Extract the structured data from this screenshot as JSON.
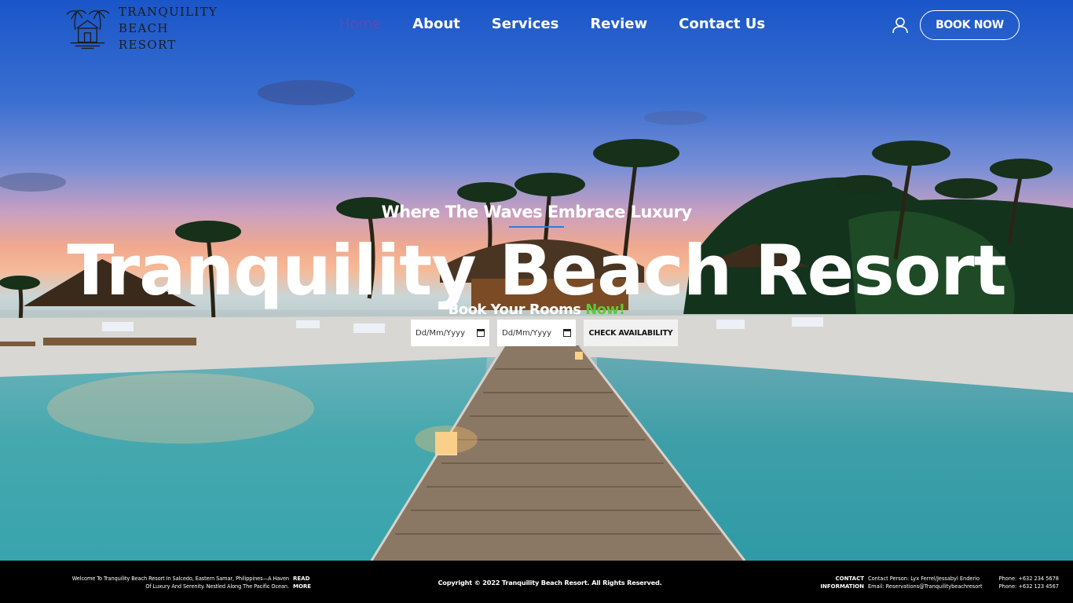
{
  "brand": {
    "line1": "TRANQUILITY",
    "line2": "BEACH RESORT",
    "logo_icon": "palm-hut-logo"
  },
  "nav": {
    "items": [
      {
        "label": "Home",
        "active": true
      },
      {
        "label": "About",
        "active": false
      },
      {
        "label": "Services",
        "active": false
      },
      {
        "label": "Review",
        "active": false
      },
      {
        "label": "Contact Us",
        "active": false
      }
    ],
    "active_color": "#5a4bb8"
  },
  "header": {
    "user_icon": "user-icon",
    "book_now_label": "BOOK NOW"
  },
  "hero": {
    "tagline": "Where The Waves Embrace Luxury",
    "title": "Tranquility Beach Resort",
    "book_prefix": "Book Your Rooms ",
    "book_highlight": "Now!",
    "highlight_color": "#5fc837",
    "checkin_placeholder": "Dd/Mm/Yyyy",
    "checkout_placeholder": "Dd/Mm/Yyyy",
    "calendar_icon": "calendar-icon",
    "check_label": "CHECK AVAILABILITY"
  },
  "footer": {
    "welcome_line1": "Welcome To Tranquility Beach Resort In Salcedo, Eastern Samar, Philippines—A Haven",
    "welcome_line2": "Of Luxury And Serenity. Nestled Along The Pacific Ocean.",
    "read_more_1": "READ",
    "read_more_2": "MORE",
    "copyright": "Copyright © 2022 Tranquility Beach Resort. All Rights Reserved.",
    "contact_head_1": "CONTACT",
    "contact_head_2": "INFORMATION",
    "contact_person": "Contact Person: Lyx Ferrel/Jessabyl Enderio",
    "contact_email": "Email: Reservations@Tranquilitybeachresort",
    "phone_1": "Phone: +632 234 5678",
    "phone_2": "Phone: +632 123 4567"
  }
}
